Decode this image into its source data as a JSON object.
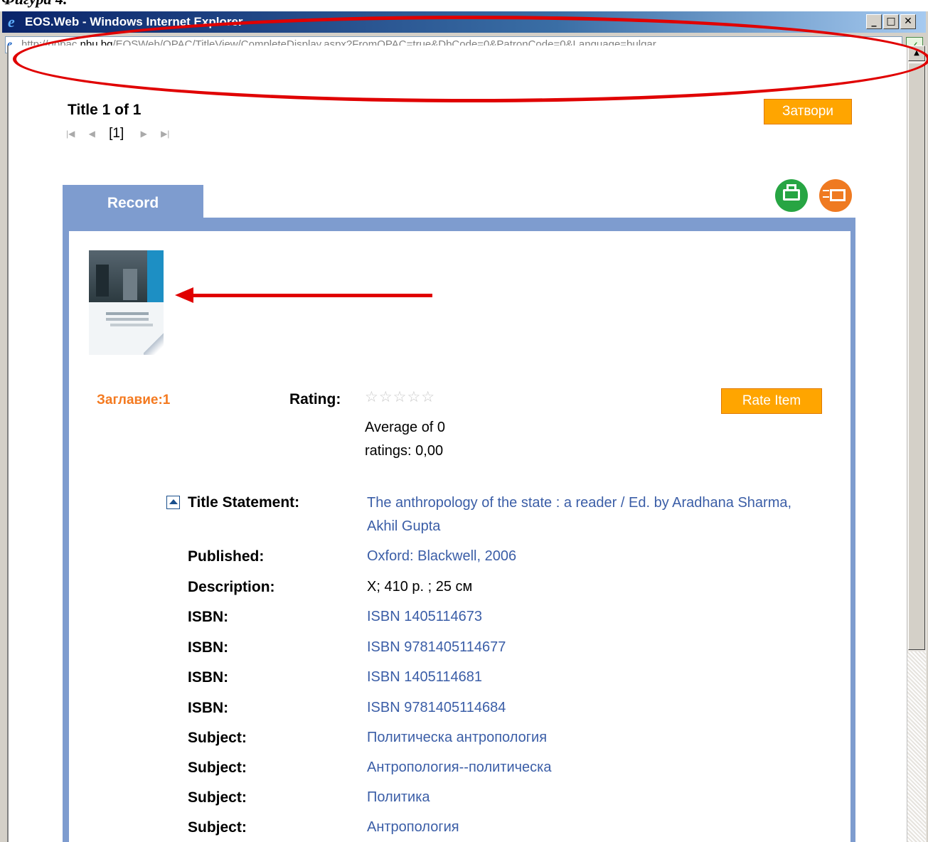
{
  "figure_caption": "Фигура 4.",
  "window": {
    "title": "EOS.Web - Windows Internet Explorer",
    "url_prefix": "http://qopac.",
    "url_host": "nbu.bg",
    "url_rest": "/EOSWeb/OPAC/TitleView/CompleteDisplay.aspx?FromOPAC=true&DbCode=0&PatronCode=0&Language=bulgar",
    "minimize_label": "_",
    "maximize_label": "□",
    "close_label": "✕"
  },
  "page": {
    "title_count": "Title 1 of 1",
    "pager": {
      "first": "|◀",
      "prev": "◀",
      "current": "[1]",
      "next": "▶",
      "last": "▶|"
    },
    "close_button": "Затвори",
    "tab_label": "Record",
    "icons": [
      "print-icon",
      "email-icon"
    ],
    "title_number": "Заглавие:1",
    "rating_label": "Rating:",
    "stars": "☆☆☆☆☆",
    "average_line1": "Average of 0",
    "average_line2": "ratings: 0,00",
    "rate_button": "Rate Item",
    "fields": [
      {
        "label": "Title Statement:",
        "value": "The anthropology of the state : a reader / Ed. by Aradhana Sharma, Akhil Gupta"
      },
      {
        "label": "Published:",
        "value": "Oxford: Blackwell, 2006"
      },
      {
        "label": "Description:",
        "value": "X; 410 p. ; 25 см"
      },
      {
        "label": "ISBN:",
        "value": "ISBN 1405114673"
      },
      {
        "label": "ISBN:",
        "value": "ISBN 9781405114677"
      },
      {
        "label": "ISBN:",
        "value": "ISBN 1405114681"
      },
      {
        "label": "ISBN:",
        "value": "ISBN 9781405114684"
      },
      {
        "label": "Subject:",
        "value": "Политическа антропология"
      },
      {
        "label": "Subject:",
        "value": "Антропология--политическа"
      },
      {
        "label": "Subject:",
        "value": "Политика"
      },
      {
        "label": "Subject:",
        "value": "Антропология"
      }
    ]
  },
  "colors": {
    "accent_orange": "#ffa500",
    "tab_blue": "#7e9ccf",
    "link_blue": "#3b5ea7",
    "annotation_red": "#e00000"
  }
}
